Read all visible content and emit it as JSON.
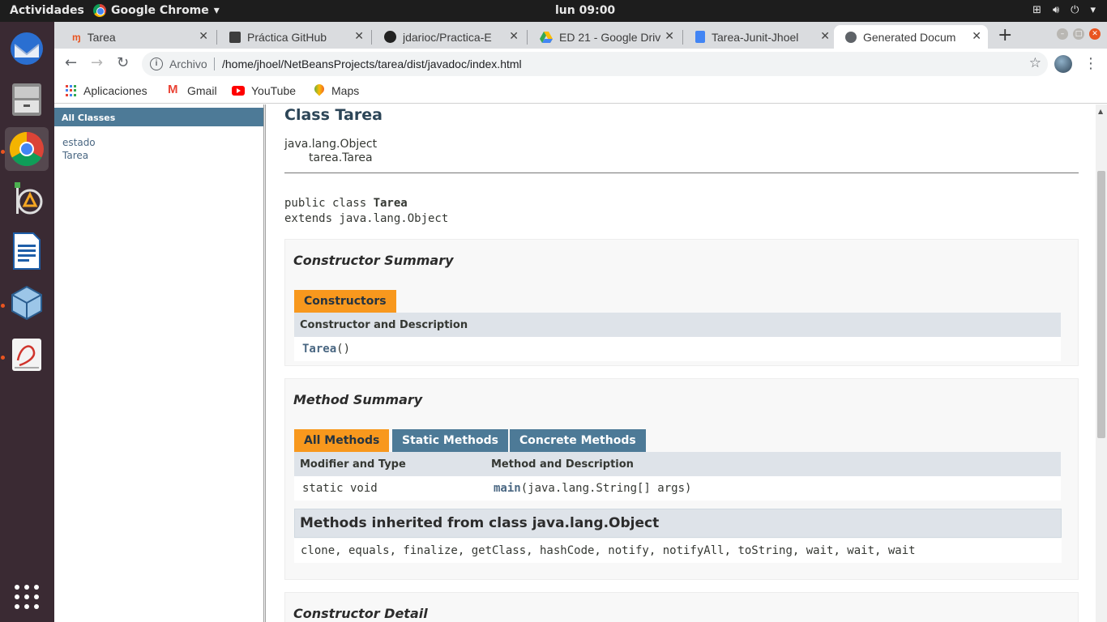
{
  "topbar": {
    "activities": "Actividades",
    "app_name": "Google Chrome",
    "clock": "lun 09:00"
  },
  "tabs": [
    {
      "title": "Tarea",
      "icon": "maze-icon"
    },
    {
      "title": "Práctica GitHub",
      "icon": "page-icon"
    },
    {
      "title": "jdarioc/Practica-E",
      "icon": "github-icon"
    },
    {
      "title": "ED 21 - Google Driv",
      "icon": "drive-icon"
    },
    {
      "title": "Tarea-Junit-Jhoel",
      "icon": "docs-icon"
    },
    {
      "title": "Generated Docum",
      "icon": "globe-icon"
    }
  ],
  "address": {
    "scheme_label": "Archivo",
    "url": "/home/jhoel/NetBeansProjects/tarea/dist/javadoc/index.html"
  },
  "bookmarks": [
    "Aplicaciones",
    "Gmail",
    "YouTube",
    "Maps"
  ],
  "left_frame": {
    "header": "All Classes",
    "classes": [
      "estado",
      "Tarea"
    ]
  },
  "doc": {
    "title": "Class Tarea",
    "inheritance": [
      "java.lang.Object",
      "tarea.Tarea"
    ],
    "decl_line1_prefix": "public class ",
    "decl_line1_name": "Tarea",
    "decl_line2": "extends java.lang.Object",
    "constructor_summary": {
      "heading": "Constructor Summary",
      "tab": "Constructors",
      "col_header": "Constructor and Description",
      "row_name": "Tarea",
      "row_params": "()"
    },
    "method_summary": {
      "heading": "Method Summary",
      "tabs": [
        "All Methods",
        "Static Methods",
        "Concrete Methods"
      ],
      "col_headers": [
        "Modifier and Type",
        "Method and Description"
      ],
      "row_modifier": "static void",
      "row_method_name": "main",
      "row_method_params": "(java.lang.String[] args)",
      "inherited_heading": "Methods inherited from class java.lang.Object",
      "inherited_list": "clone, equals, finalize, getClass, hashCode, notify, notifyAll, toString, wait, wait, wait"
    },
    "constructor_detail_heading": "Constructor Detail"
  },
  "colors": {
    "javadoc_blue": "#4d7a97",
    "javadoc_orange": "#f8981d",
    "dock_bg": "#3a2a33",
    "ubuntu_orange": "#e95420"
  }
}
